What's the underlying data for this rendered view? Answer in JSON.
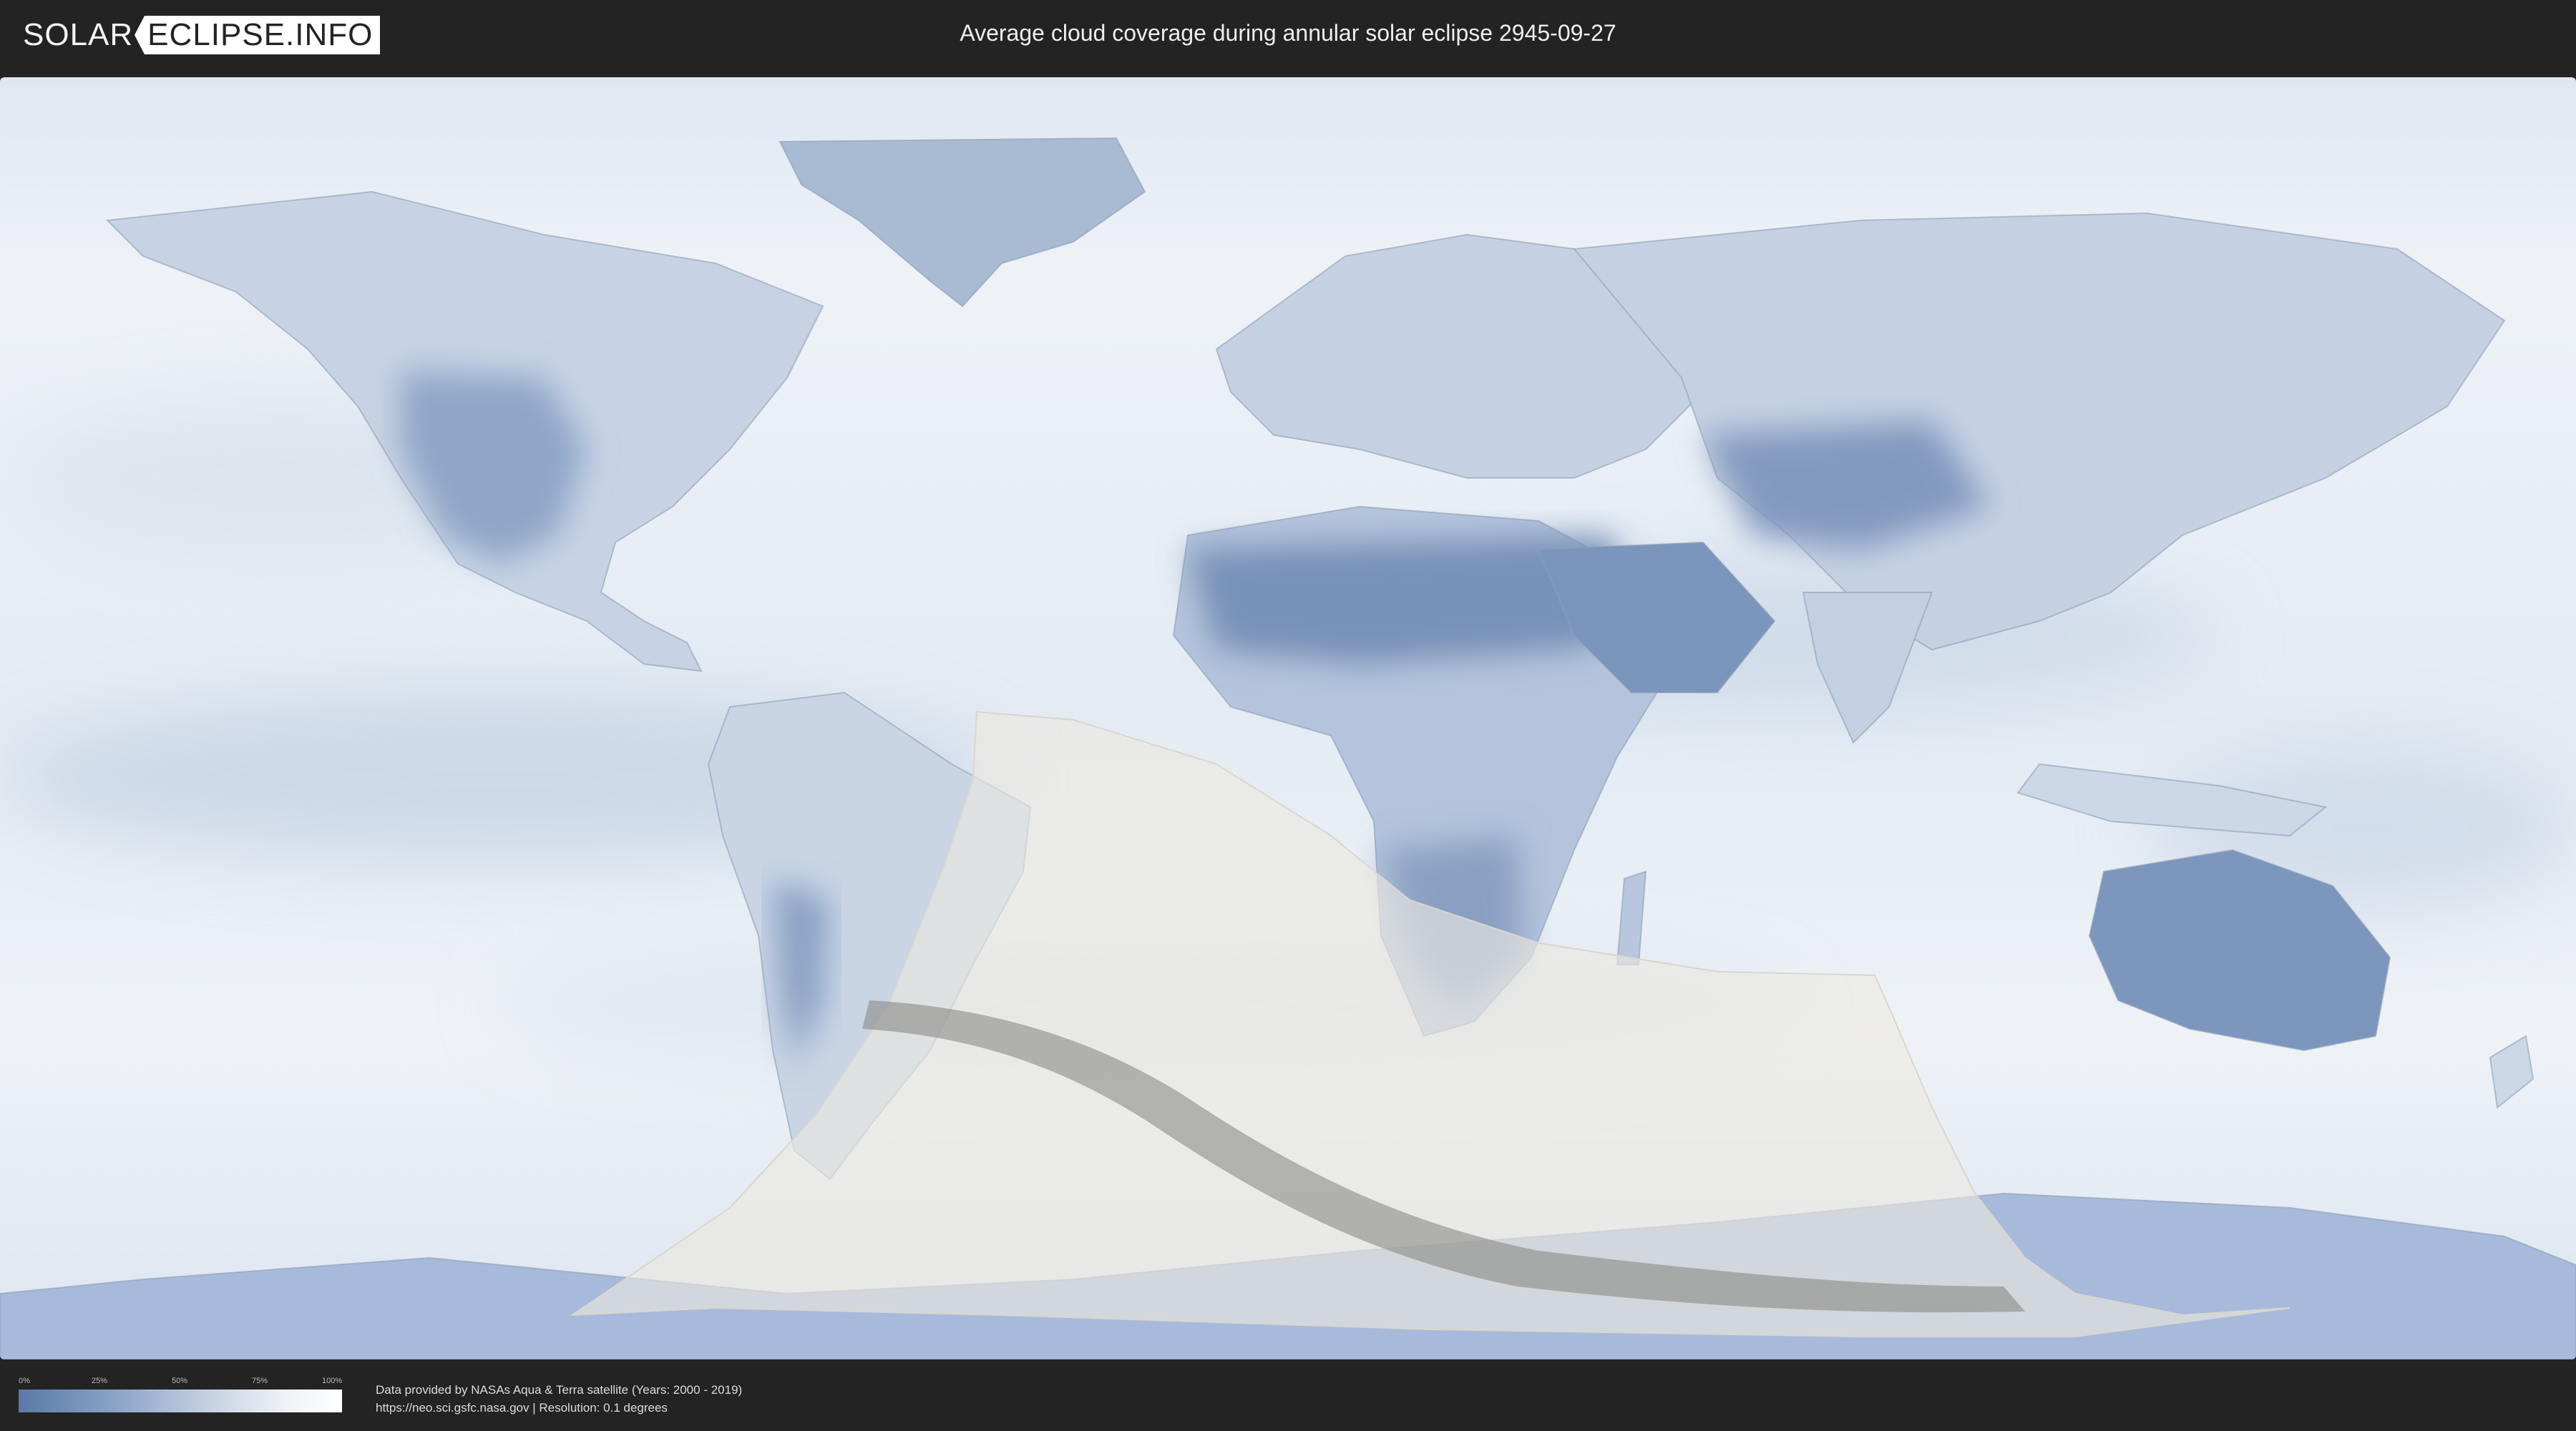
{
  "header": {
    "logo_left": "SOLAR",
    "logo_right": "ECLIPSE.INFO",
    "title": "Average cloud coverage during annular solar eclipse 2945-09-27"
  },
  "legend": {
    "ticks": [
      "0%",
      "25%",
      "50%",
      "75%",
      "100%"
    ],
    "colors": {
      "low": "#5a79a8",
      "high": "#ffffff"
    }
  },
  "footer": {
    "credit_line1": "Data provided by NASAs Aqua & Terra satellite (Years: 2000 - 2019)",
    "credit_line2": "https://neo.sci.gsfc.nasa.gov | Resolution: 0.1 degrees"
  },
  "map": {
    "type": "cloud-coverage-world-map",
    "colors": {
      "ocean_cloud": "#e6ecf3",
      "land_low_cloud": "#7d95bb",
      "eclipse_region": "#e9e6df",
      "central_path": "#8a8a86"
    }
  }
}
